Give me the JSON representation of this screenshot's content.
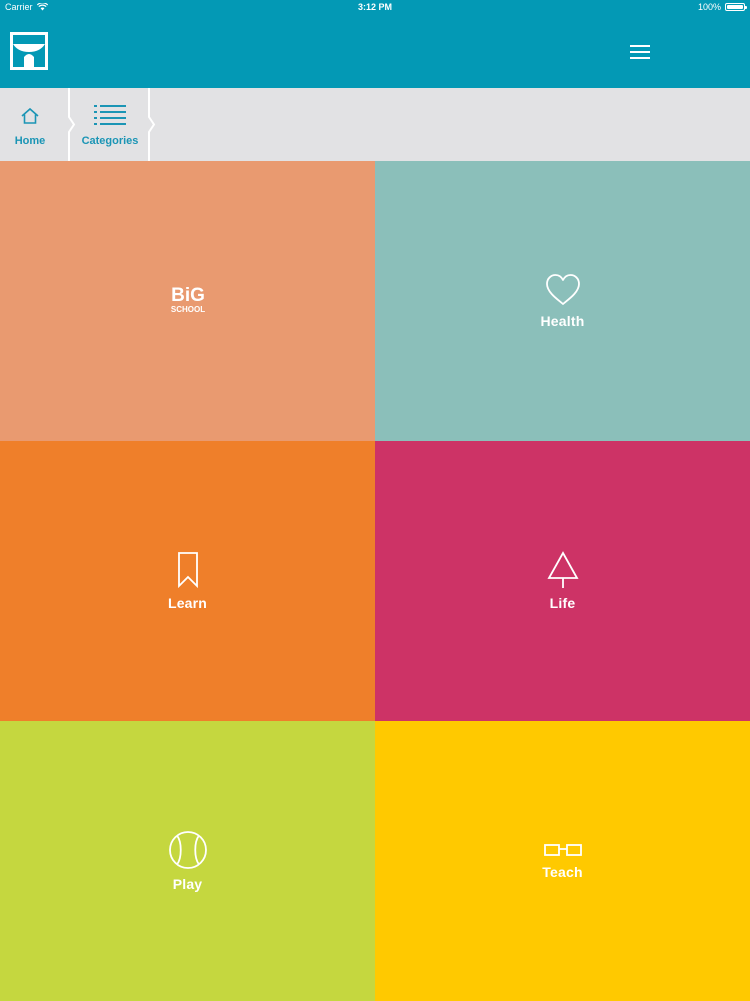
{
  "status_bar": {
    "carrier": "Carrier",
    "time": "3:12 PM",
    "battery": "100%"
  },
  "header": {
    "logo_icon": "brand-logo-icon",
    "menu_icon": "hamburger-menu-icon",
    "background": "#0399b5"
  },
  "breadcrumb": {
    "home_label": "Home",
    "categories_label": "Categories",
    "accent": "#1b95b5"
  },
  "tiles": [
    {
      "label": "",
      "logo_text": [
        "BiG",
        "SCHOOL"
      ],
      "icon": "big-school-logo",
      "color": "#e99a70"
    },
    {
      "label": "Health",
      "icon": "heart-icon",
      "color": "#8bbfba"
    },
    {
      "label": "Learn",
      "icon": "bookmark-icon",
      "color": "#ef7f2a"
    },
    {
      "label": "Life",
      "icon": "tree-icon",
      "color": "#cd3366"
    },
    {
      "label": "Play",
      "icon": "tennis-ball-icon",
      "color": "#c5d73f"
    },
    {
      "label": "Teach",
      "icon": "glasses-icon",
      "color": "#ffc900"
    }
  ]
}
